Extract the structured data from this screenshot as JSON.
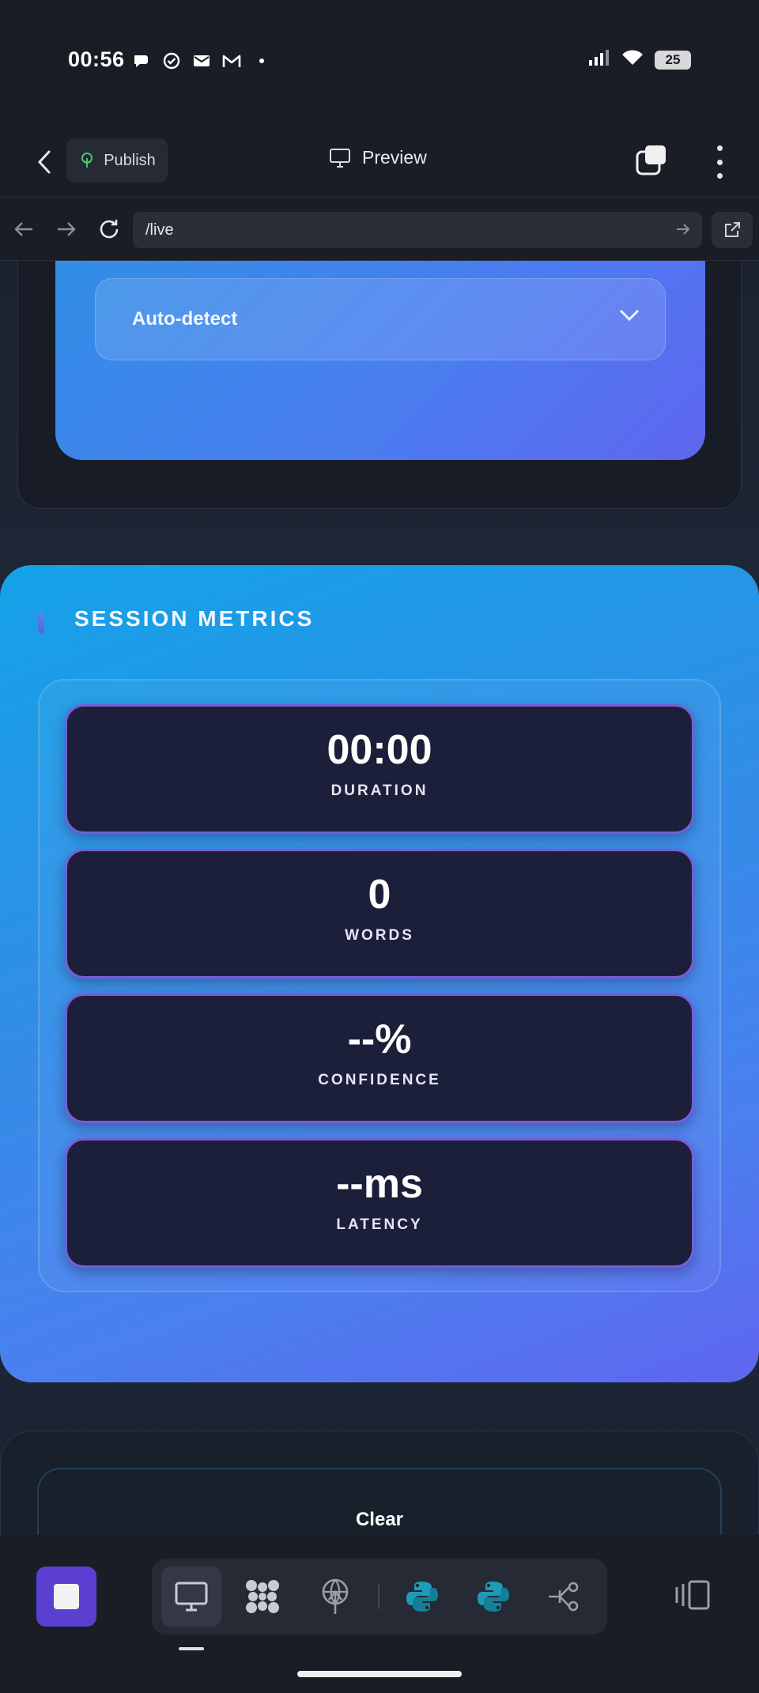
{
  "status_bar": {
    "time": "00:56",
    "battery": "25",
    "icons_left": [
      "chat-bubble-icon",
      "check-circle-icon",
      "mail-icon",
      "gmail-icon",
      "dot-icon"
    ],
    "icons_right": [
      "signal-icon",
      "wifi-icon",
      "battery-icon"
    ]
  },
  "header": {
    "publish_label": "Publish",
    "preview_label": "Preview"
  },
  "url_bar": {
    "path": "/live"
  },
  "language_card": {
    "selected": "Auto-detect"
  },
  "metrics": {
    "title": "SESSION METRICS",
    "items": [
      {
        "value": "00:00",
        "label": "DURATION"
      },
      {
        "value": "0",
        "label": "WORDS"
      },
      {
        "value": "--%",
        "label": "CONFIDENCE"
      },
      {
        "value": "--ms",
        "label": "LATENCY"
      }
    ]
  },
  "controls": {
    "clear_label": "Clear"
  },
  "toolbar": {
    "tools": [
      "monitor-icon",
      "grid-icon",
      "broadcast-icon",
      "python-icon",
      "python-icon",
      "connection-icon"
    ],
    "active_tool": "monitor-icon",
    "accent": "#5a3fd0"
  },
  "colors": {
    "background": "#1a1d26",
    "metrics_gradient_start": "#14a2e8",
    "metrics_gradient_end": "#5f66ef",
    "metric_box": "#1b1f3a",
    "metric_border": "#7a5bd8"
  }
}
